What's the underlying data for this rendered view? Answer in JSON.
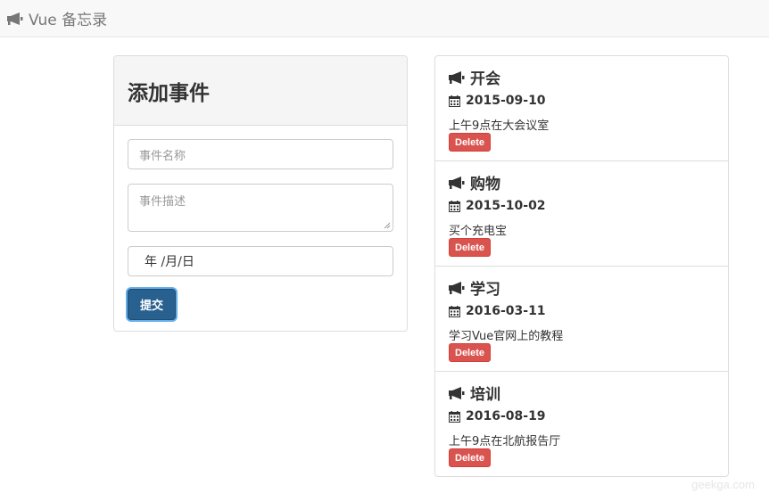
{
  "navbar": {
    "brand_icon": "bullhorn-icon",
    "brand": "Vue 备忘录"
  },
  "form": {
    "title": "添加事件",
    "name_placeholder": "事件名称",
    "desc_placeholder": "事件描述",
    "date_value": "年 /月/日",
    "submit_label": "提交",
    "submit_color": "#286090"
  },
  "events": [
    {
      "title": "开会",
      "date": "2015-09-10",
      "description": "上午9点在大会议室",
      "delete_label": "Delete"
    },
    {
      "title": "购物",
      "date": "2015-10-02",
      "description": "买个充电宝",
      "delete_label": "Delete"
    },
    {
      "title": "学习",
      "date": "2016-03-11",
      "description": "学习Vue官网上的教程",
      "delete_label": "Delete"
    },
    {
      "title": "培训",
      "date": "2016-08-19",
      "description": "上午9点在北航报告厅",
      "delete_label": "Delete"
    }
  ],
  "icons": {
    "title": "bullhorn-icon",
    "date": "calendar-icon"
  },
  "colors": {
    "delete": "#d9534f",
    "navbar_bg": "#f8f8f8"
  },
  "watermark": "geekga.com"
}
